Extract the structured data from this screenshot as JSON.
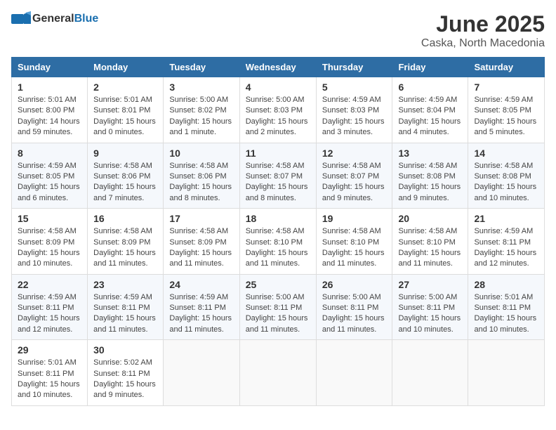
{
  "header": {
    "logo_general": "General",
    "logo_blue": "Blue",
    "month": "June 2025",
    "location": "Caska, North Macedonia"
  },
  "days_of_week": [
    "Sunday",
    "Monday",
    "Tuesday",
    "Wednesday",
    "Thursday",
    "Friday",
    "Saturday"
  ],
  "weeks": [
    [
      {
        "day": 1,
        "lines": [
          "Sunrise: 5:01 AM",
          "Sunset: 8:00 PM",
          "Daylight: 14 hours",
          "and 59 minutes."
        ]
      },
      {
        "day": 2,
        "lines": [
          "Sunrise: 5:01 AM",
          "Sunset: 8:01 PM",
          "Daylight: 15 hours",
          "and 0 minutes."
        ]
      },
      {
        "day": 3,
        "lines": [
          "Sunrise: 5:00 AM",
          "Sunset: 8:02 PM",
          "Daylight: 15 hours",
          "and 1 minute."
        ]
      },
      {
        "day": 4,
        "lines": [
          "Sunrise: 5:00 AM",
          "Sunset: 8:03 PM",
          "Daylight: 15 hours",
          "and 2 minutes."
        ]
      },
      {
        "day": 5,
        "lines": [
          "Sunrise: 4:59 AM",
          "Sunset: 8:03 PM",
          "Daylight: 15 hours",
          "and 3 minutes."
        ]
      },
      {
        "day": 6,
        "lines": [
          "Sunrise: 4:59 AM",
          "Sunset: 8:04 PM",
          "Daylight: 15 hours",
          "and 4 minutes."
        ]
      },
      {
        "day": 7,
        "lines": [
          "Sunrise: 4:59 AM",
          "Sunset: 8:05 PM",
          "Daylight: 15 hours",
          "and 5 minutes."
        ]
      }
    ],
    [
      {
        "day": 8,
        "lines": [
          "Sunrise: 4:59 AM",
          "Sunset: 8:05 PM",
          "Daylight: 15 hours",
          "and 6 minutes."
        ]
      },
      {
        "day": 9,
        "lines": [
          "Sunrise: 4:58 AM",
          "Sunset: 8:06 PM",
          "Daylight: 15 hours",
          "and 7 minutes."
        ]
      },
      {
        "day": 10,
        "lines": [
          "Sunrise: 4:58 AM",
          "Sunset: 8:06 PM",
          "Daylight: 15 hours",
          "and 8 minutes."
        ]
      },
      {
        "day": 11,
        "lines": [
          "Sunrise: 4:58 AM",
          "Sunset: 8:07 PM",
          "Daylight: 15 hours",
          "and 8 minutes."
        ]
      },
      {
        "day": 12,
        "lines": [
          "Sunrise: 4:58 AM",
          "Sunset: 8:07 PM",
          "Daylight: 15 hours",
          "and 9 minutes."
        ]
      },
      {
        "day": 13,
        "lines": [
          "Sunrise: 4:58 AM",
          "Sunset: 8:08 PM",
          "Daylight: 15 hours",
          "and 9 minutes."
        ]
      },
      {
        "day": 14,
        "lines": [
          "Sunrise: 4:58 AM",
          "Sunset: 8:08 PM",
          "Daylight: 15 hours",
          "and 10 minutes."
        ]
      }
    ],
    [
      {
        "day": 15,
        "lines": [
          "Sunrise: 4:58 AM",
          "Sunset: 8:09 PM",
          "Daylight: 15 hours",
          "and 10 minutes."
        ]
      },
      {
        "day": 16,
        "lines": [
          "Sunrise: 4:58 AM",
          "Sunset: 8:09 PM",
          "Daylight: 15 hours",
          "and 11 minutes."
        ]
      },
      {
        "day": 17,
        "lines": [
          "Sunrise: 4:58 AM",
          "Sunset: 8:09 PM",
          "Daylight: 15 hours",
          "and 11 minutes."
        ]
      },
      {
        "day": 18,
        "lines": [
          "Sunrise: 4:58 AM",
          "Sunset: 8:10 PM",
          "Daylight: 15 hours",
          "and 11 minutes."
        ]
      },
      {
        "day": 19,
        "lines": [
          "Sunrise: 4:58 AM",
          "Sunset: 8:10 PM",
          "Daylight: 15 hours",
          "and 11 minutes."
        ]
      },
      {
        "day": 20,
        "lines": [
          "Sunrise: 4:58 AM",
          "Sunset: 8:10 PM",
          "Daylight: 15 hours",
          "and 11 minutes."
        ]
      },
      {
        "day": 21,
        "lines": [
          "Sunrise: 4:59 AM",
          "Sunset: 8:11 PM",
          "Daylight: 15 hours",
          "and 12 minutes."
        ]
      }
    ],
    [
      {
        "day": 22,
        "lines": [
          "Sunrise: 4:59 AM",
          "Sunset: 8:11 PM",
          "Daylight: 15 hours",
          "and 12 minutes."
        ]
      },
      {
        "day": 23,
        "lines": [
          "Sunrise: 4:59 AM",
          "Sunset: 8:11 PM",
          "Daylight: 15 hours",
          "and 11 minutes."
        ]
      },
      {
        "day": 24,
        "lines": [
          "Sunrise: 4:59 AM",
          "Sunset: 8:11 PM",
          "Daylight: 15 hours",
          "and 11 minutes."
        ]
      },
      {
        "day": 25,
        "lines": [
          "Sunrise: 5:00 AM",
          "Sunset: 8:11 PM",
          "Daylight: 15 hours",
          "and 11 minutes."
        ]
      },
      {
        "day": 26,
        "lines": [
          "Sunrise: 5:00 AM",
          "Sunset: 8:11 PM",
          "Daylight: 15 hours",
          "and 11 minutes."
        ]
      },
      {
        "day": 27,
        "lines": [
          "Sunrise: 5:00 AM",
          "Sunset: 8:11 PM",
          "Daylight: 15 hours",
          "and 10 minutes."
        ]
      },
      {
        "day": 28,
        "lines": [
          "Sunrise: 5:01 AM",
          "Sunset: 8:11 PM",
          "Daylight: 15 hours",
          "and 10 minutes."
        ]
      }
    ],
    [
      {
        "day": 29,
        "lines": [
          "Sunrise: 5:01 AM",
          "Sunset: 8:11 PM",
          "Daylight: 15 hours",
          "and 10 minutes."
        ]
      },
      {
        "day": 30,
        "lines": [
          "Sunrise: 5:02 AM",
          "Sunset: 8:11 PM",
          "Daylight: 15 hours",
          "and 9 minutes."
        ]
      },
      null,
      null,
      null,
      null,
      null
    ]
  ]
}
